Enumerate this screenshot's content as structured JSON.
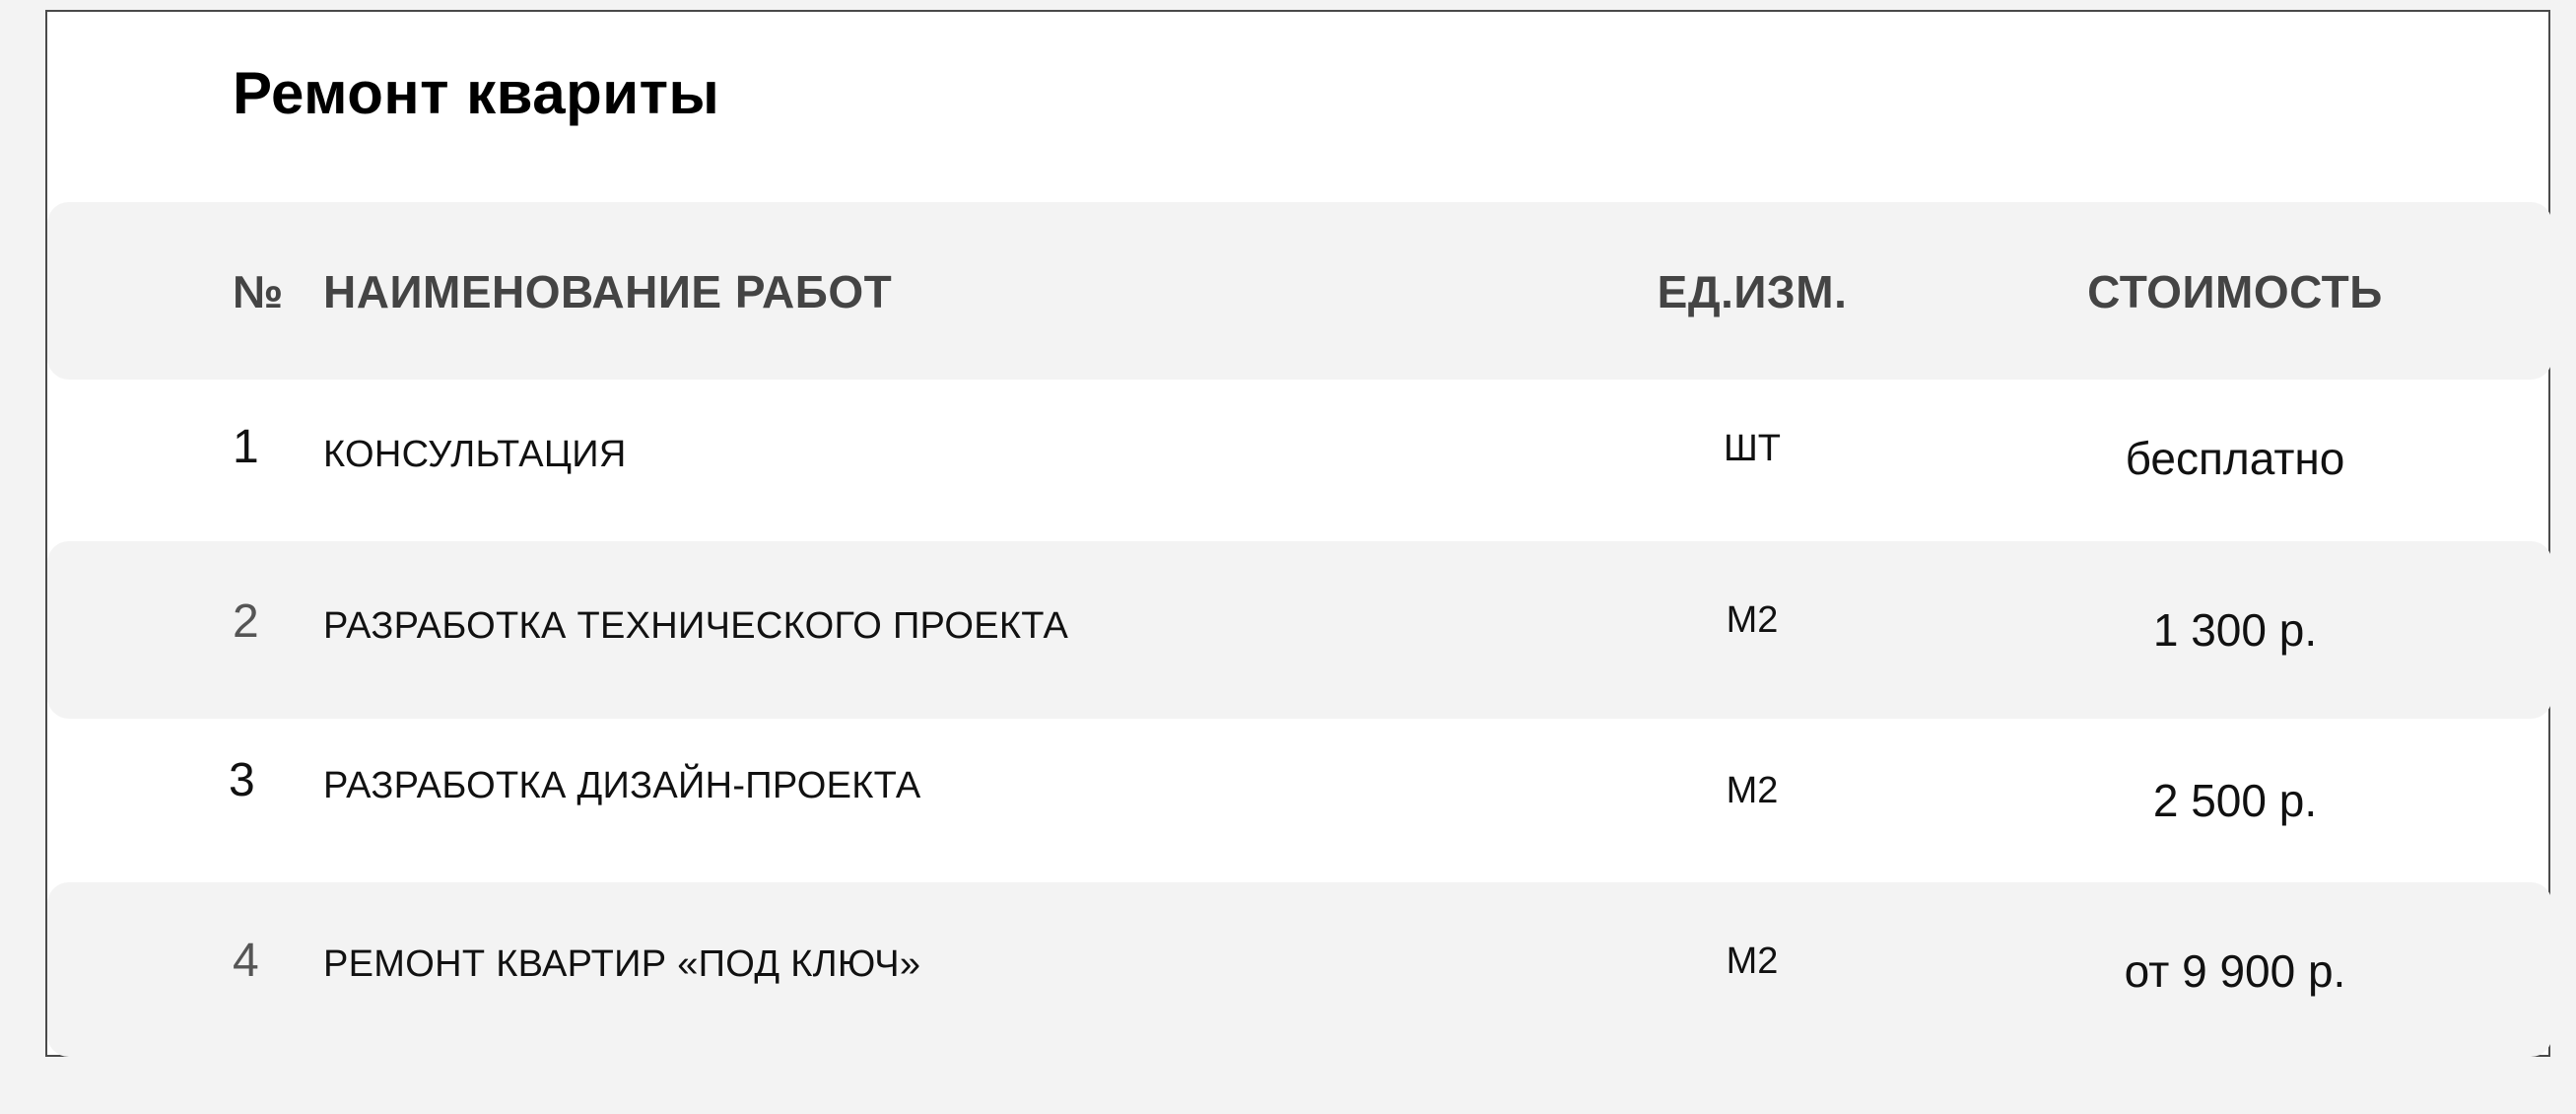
{
  "page": {
    "title": "Ремонт квариты"
  },
  "table": {
    "headers": {
      "number": "№",
      "name": "НАИМЕНОВАНИЕ РАБОТ",
      "unit": "ЕД.ИЗМ.",
      "price": "СТОИМОСТЬ"
    },
    "rows": [
      {
        "number": "1",
        "name": "КОНСУЛЬТАЦИЯ",
        "unit": "ШТ",
        "price": "бесплатно"
      },
      {
        "number": "2",
        "name": "РАЗРАБОТКА ТЕХНИЧЕСКОГО ПРОЕКТА",
        "unit": "М2",
        "price": "1 300 р."
      },
      {
        "number": "3",
        "name": "РАЗРАБОТКА ДИЗАЙН-ПРОЕКТА",
        "unit": "М2",
        "price": "2 500 р."
      },
      {
        "number": "4",
        "name": "РЕМОНТ КВАРТИР «ПОД КЛЮЧ»",
        "unit": "М2",
        "price": "от 9 900 р."
      }
    ]
  },
  "colors": {
    "page_background": "#f3f3f3",
    "card_background": "#ffffff",
    "stripe_background": "#f3f3f3",
    "header_text": "#444444",
    "body_text": "#111111"
  }
}
